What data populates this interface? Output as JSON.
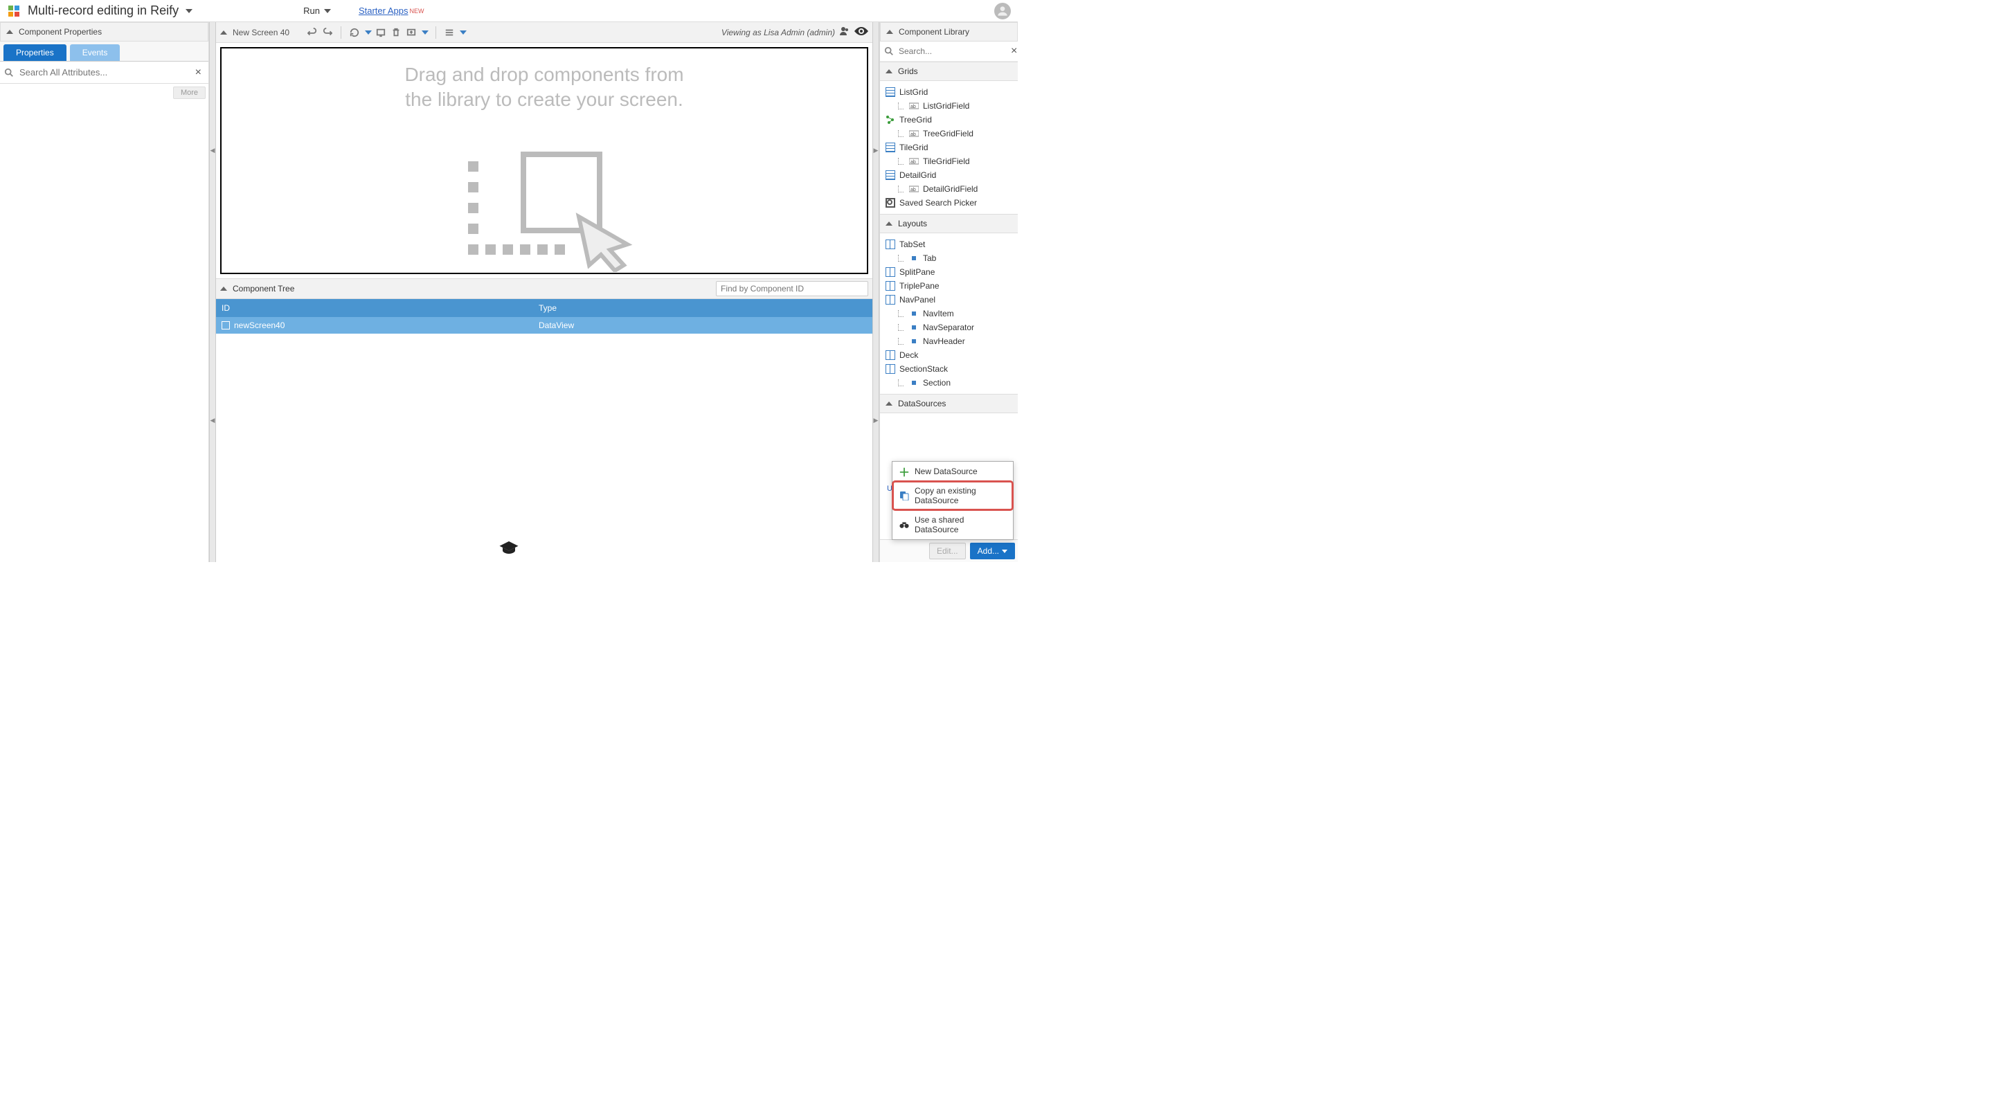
{
  "header": {
    "app_title": "Multi-record editing in Reify",
    "run_label": "Run",
    "starter_apps_label": "Starter Apps",
    "new_badge": "NEW"
  },
  "left_panel": {
    "title": "Component Properties",
    "tabs": {
      "properties": "Properties",
      "events": "Events"
    },
    "search_placeholder": "Search All Attributes...",
    "more_btn": "More"
  },
  "center": {
    "screen_name": "New Screen 40",
    "viewing_as": "Viewing as Lisa Admin (admin)",
    "canvas_hint_line1": "Drag and drop components from",
    "canvas_hint_line2": "the library to create your screen.",
    "tree_title": "Component Tree",
    "tree_search_placeholder": "Find by Component ID",
    "tree_columns": {
      "id": "ID",
      "type": "Type"
    },
    "tree_row": {
      "id": "newScreen40",
      "type": "DataView"
    }
  },
  "right_panel": {
    "title": "Component Library",
    "search_placeholder": "Search...",
    "sections": {
      "grids": {
        "label": "Grids",
        "items": [
          "ListGrid",
          "ListGridField",
          "TreeGrid",
          "TreeGridField",
          "TileGrid",
          "TileGridField",
          "DetailGrid",
          "DetailGridField",
          "Saved Search Picker"
        ],
        "child_flags": [
          false,
          true,
          false,
          true,
          false,
          true,
          false,
          true,
          false
        ]
      },
      "layouts": {
        "label": "Layouts",
        "items": [
          "TabSet",
          "Tab",
          "SplitPane",
          "TriplePane",
          "NavPanel",
          "NavItem",
          "NavSeparator",
          "NavHeader",
          "Deck",
          "SectionStack",
          "Section"
        ],
        "child_flags": [
          false,
          true,
          false,
          false,
          false,
          true,
          true,
          true,
          false,
          false,
          true
        ]
      },
      "datasources": {
        "label": "DataSources"
      }
    },
    "us_partial": "Us",
    "edit_btn": "Edit...",
    "add_btn": "Add..."
  },
  "popup": {
    "new_ds": "New DataSource",
    "copy_ds": "Copy an existing DataSource",
    "shared_ds": "Use a shared DataSource"
  }
}
